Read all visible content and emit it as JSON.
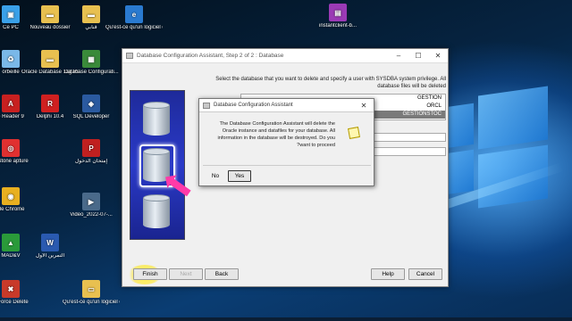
{
  "desktop": {
    "icons": [
      {
        "label": "Ce PC",
        "icon": "computer-icon",
        "color": "#3aa0e8"
      },
      {
        "label": "Nouveau dossier",
        "icon": "folder-icon",
        "color": "#e8c050"
      },
      {
        "label": "قنابي",
        "icon": "folder-icon",
        "color": "#e8c050"
      },
      {
        "label": "Qu'est-ce qu'un logiciel d'appli...",
        "icon": "edge-icon",
        "color": "#2a7ad0"
      },
      {
        "label": "instantclient-b...",
        "icon": "winrar-icon",
        "color": "#9b3ab5"
      },
      {
        "label": "orbeille",
        "icon": "recycle-bin-icon",
        "color": "#7ab8e8"
      },
      {
        "label": "Oracle Database 11g Release 2",
        "icon": "folder-icon",
        "color": "#e8c050"
      },
      {
        "label": "Database Configurati...",
        "icon": "dbca-icon",
        "color": "#3a8a3a"
      },
      {
        "label": "e Reader 9",
        "icon": "acrobat-icon",
        "color": "#c82020"
      },
      {
        "label": "Delphi 10.4",
        "icon": "delphi-icon",
        "color": "#d02020"
      },
      {
        "label": "SQL Developer",
        "icon": "sql-developer-icon",
        "color": "#2a5aa0"
      },
      {
        "label": "otStone apture",
        "icon": "faststone-icon",
        "color": "#e03030"
      },
      {
        "label": "إمتحان الدخول",
        "icon": "pdf-icon",
        "color": "#c02020"
      },
      {
        "label": "gle Chrome",
        "icon": "chrome-icon",
        "color": "#e8b020"
      },
      {
        "label": "Video_2022-07-...",
        "icon": "video-icon",
        "color": "#4a6a8a"
      },
      {
        "label": "MAD&V",
        "icon": "mad-icon",
        "color": "#2a9a3a"
      },
      {
        "label": "التمرين الأول",
        "icon": "word-icon",
        "color": "#2a5ab0"
      },
      {
        "label": "e Force Delete",
        "icon": "force-delete-icon",
        "color": "#c83a2a"
      },
      {
        "label": "Qu'est-ce qu'un logiciel d'appli...",
        "icon": "document-icon",
        "color": "#e8c050"
      }
    ]
  },
  "dbca": {
    "title": "Database Configuration Assistant, Step 2 of 2 : Database",
    "instruction": "Select the database that you want to delete and specify a user with SYSDBA system privilege. All database files will be deleted",
    "databases": [
      "GESTION",
      "ORCL",
      "GESTIONSTOC"
    ],
    "selected_db": "GESTIONSTOC",
    "buttons": {
      "finish": "Finish",
      "next": "Next",
      "back": "Back",
      "help": "Help",
      "cancel": "Cancel"
    }
  },
  "dialog": {
    "title": "Database Configuration Assistant",
    "message_line1": "The Database Configuration Assistant will delete the",
    "message_line2": "Oracle instance and datafiles for your database. All",
    "message_line3": "information in the database will be destroyed. Do you",
    "message_line4": "?want to proceed",
    "no": "No",
    "yes": "Yes"
  },
  "colors": {
    "arrow": "#ff3aa8",
    "highlight": "#ffe83a",
    "selection": "#7a7a7a"
  }
}
